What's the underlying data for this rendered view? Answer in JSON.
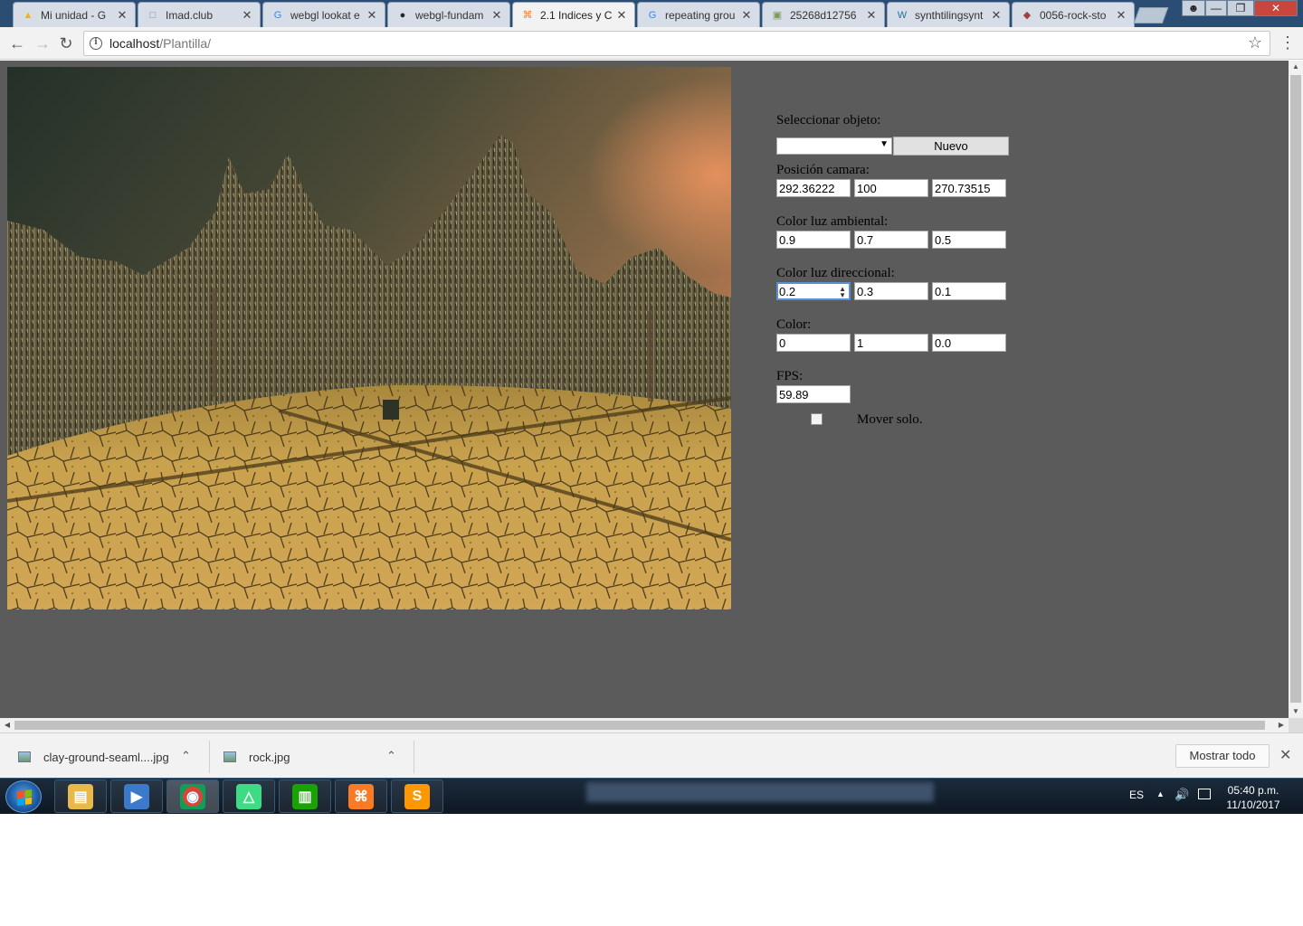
{
  "browser": {
    "tabs": [
      {
        "title": "Mi unidad - G",
        "icon": "google-drive-icon",
        "color": "#f4b400"
      },
      {
        "title": "Imad.club",
        "icon": "page-icon",
        "color": "#888888"
      },
      {
        "title": "webgl lookat e",
        "icon": "google-icon",
        "color": "#4285f4"
      },
      {
        "title": "webgl-fundam",
        "icon": "github-icon",
        "color": "#24292e"
      },
      {
        "title": "2.1 Indices y C",
        "icon": "xampp-icon",
        "color": "#fb7a24"
      },
      {
        "title": "repeating grou",
        "icon": "google-icon",
        "color": "#4285f4"
      },
      {
        "title": "25268d12756",
        "icon": "image-icon",
        "color": "#7a9a5a"
      },
      {
        "title": "synthtilingsynt",
        "icon": "wordpress-icon",
        "color": "#21759b"
      },
      {
        "title": "0056-rock-sto",
        "icon": "rock-icon",
        "color": "#a04040"
      }
    ],
    "active_tab": 4,
    "url_host": "localhost",
    "url_path": "/Plantilla/"
  },
  "panel": {
    "select_label": "Seleccionar objeto:",
    "select_value": "",
    "nuevo_label": "Nuevo",
    "camera_label": "Posición camara:",
    "camera": [
      "292.36222",
      "100",
      "270.73515"
    ],
    "ambient_label": "Color luz ambiental:",
    "ambient": [
      "0.9",
      "0.7",
      "0.5"
    ],
    "directional_label": "Color luz direccional:",
    "directional": [
      "0.2",
      "0.3",
      "0.1"
    ],
    "color_label": "Color:",
    "color": [
      "0",
      "1",
      "0.0"
    ],
    "fps_label": "FPS:",
    "fps": "59.89",
    "move_label": "Mover solo.",
    "move_checked": false
  },
  "downloads": {
    "items": [
      {
        "name": "clay-ground-seaml....jpg"
      },
      {
        "name": "rock.jpg"
      }
    ],
    "show_all": "Mostrar todo"
  },
  "taskbar": {
    "apps": [
      {
        "name": "file-explorer",
        "color": "#e8b84a"
      },
      {
        "name": "media-player",
        "color": "#3a7ac8"
      },
      {
        "name": "chrome",
        "color": "#ffffff"
      },
      {
        "name": "android-studio",
        "color": "#3ddc84"
      },
      {
        "name": "libreoffice-calc",
        "color": "#18a303"
      },
      {
        "name": "xampp",
        "color": "#fb7a24"
      },
      {
        "name": "sublime-text",
        "color": "#ff9800"
      }
    ],
    "lang": "ES",
    "time": "05:40 p.m.",
    "date": "11/10/2017"
  },
  "colors": {
    "page_bg": "#5b5b5b",
    "sky_top": "#2a3a32",
    "sky_sunset": "#d8895a",
    "ground": "#c9a24e"
  }
}
